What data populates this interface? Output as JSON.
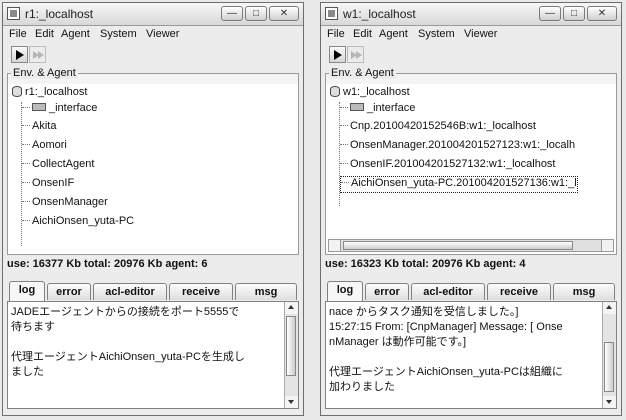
{
  "windows": [
    {
      "title": "r1:_localhost",
      "menu": [
        "File",
        "Edit",
        "Agent",
        "System",
        "Viewer"
      ],
      "panel_title": "Env. & Agent",
      "root": "r1:_localhost",
      "interface": "_interface",
      "agents": [
        "Akita",
        "Aomori",
        "CollectAgent",
        "OnsenIF",
        "OnsenManager",
        "AichiOnsen_yuta-PC"
      ],
      "status": "use: 16377 Kb   total: 20976 Kb   agent: 6",
      "tabs": [
        "log",
        "error",
        "acl-editor",
        "receive",
        "msg"
      ],
      "log_text": "JADEエージェントからの接続をポート5555で\n待ちます\n\n代理エージェントAichiOnsen_yuta-PCを生成し\nました"
    },
    {
      "title": "w1:_localhost",
      "menu": [
        "File",
        "Edit",
        "Agent",
        "System",
        "Viewer"
      ],
      "panel_title": "Env. & Agent",
      "root": "w1:_localhost",
      "interface": "_interface",
      "agents": [
        "Cnp.20100420152546B:w1:_localhost",
        "OnsenManager.201004201527123:w1:_localh",
        "OnsenIF.201004201527132:w1:_localhost",
        "AichiOnsen_yuta-PC.201004201527136:w1:_l"
      ],
      "status": "use: 16323 Kb   total: 20976 Kb   agent: 4",
      "tabs": [
        "log",
        "error",
        "acl-editor",
        "receive",
        "msg"
      ],
      "log_text": "nace からタスク通知を受信しました。]\n15:27:15 From: [CnpManager] Message: [ Onse\nnManager は動作可能です。]\n\n代理エージェントAichiOnsen_yuta-PCは組織に\n加わりました"
    }
  ]
}
